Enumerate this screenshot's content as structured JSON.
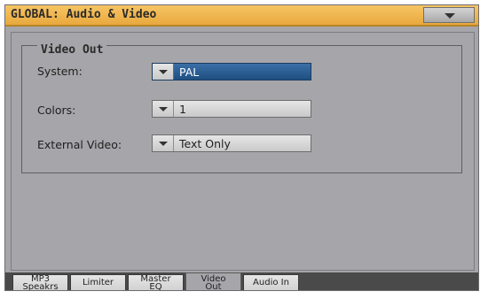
{
  "header": {
    "title": "GLOBAL: Audio & Video",
    "menu_icon": "chevron-down-icon"
  },
  "video_out": {
    "group_label": "Video Out",
    "system": {
      "label": "System:",
      "value": "PAL"
    },
    "colors": {
      "label": "Colors:",
      "value": "1"
    },
    "external_video": {
      "label": "External Video:",
      "value": "Text Only"
    }
  },
  "tabs": [
    {
      "line1": "MP3",
      "line2": "Speakrs",
      "active": false
    },
    {
      "line1": "Limiter",
      "line2": "",
      "active": false
    },
    {
      "line1": "Master",
      "line2": "EQ",
      "active": false
    },
    {
      "line1": "Video",
      "line2": "Out",
      "active": true
    },
    {
      "line1": "Audio In",
      "line2": "",
      "active": false
    }
  ],
  "colors": {
    "title_bar": "#e8a93d",
    "selected_field": "#2a5d92",
    "panel_bg": "#a6a6aa"
  }
}
